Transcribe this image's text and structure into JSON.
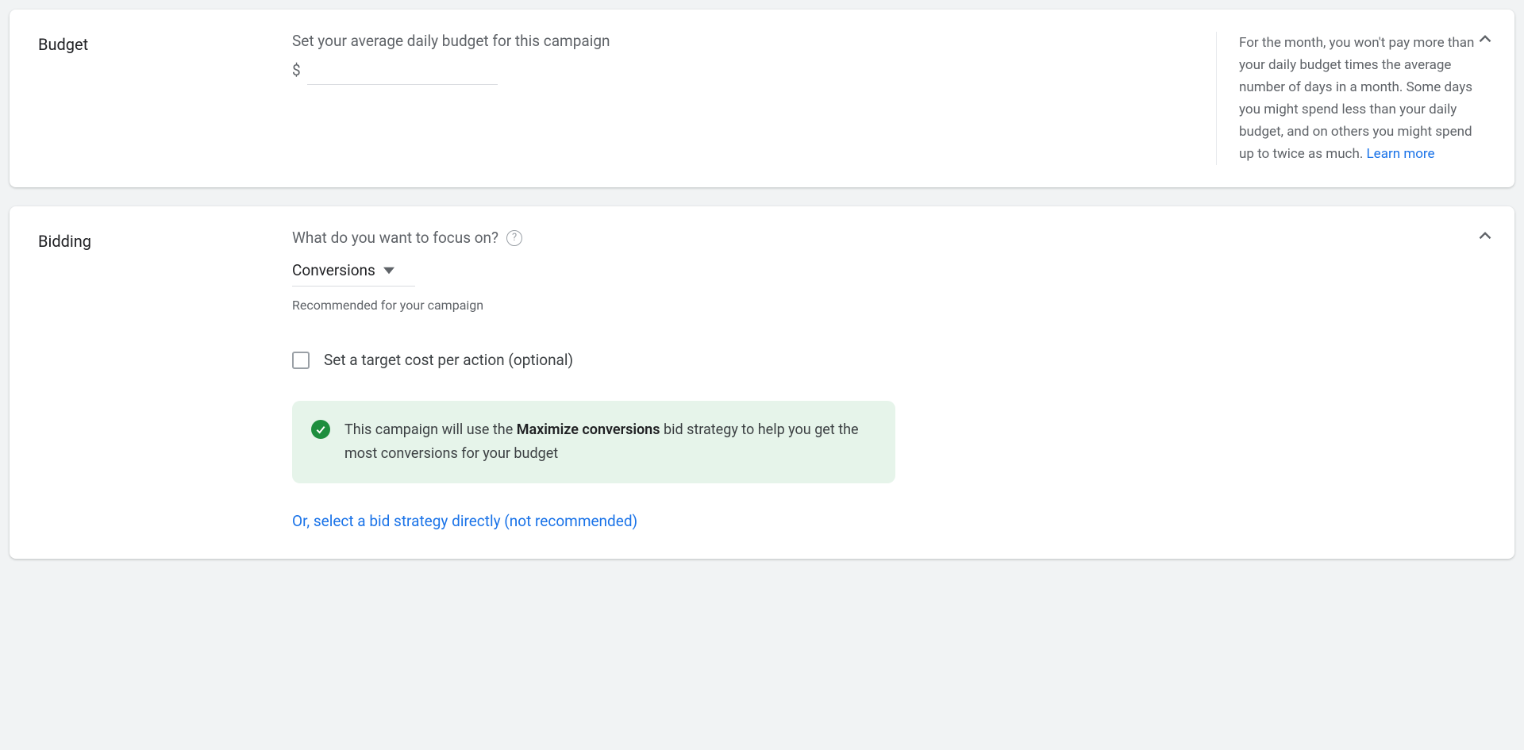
{
  "budget": {
    "title": "Budget",
    "prompt": "Set your average daily budget for this campaign",
    "currency_symbol": "$",
    "input_value": "",
    "info_text": "For the month, you won't pay more than your daily budget times the average number of days in a month. Some days you might spend less than your daily budget, and on others you might spend up to twice as much. ",
    "learn_more": "Learn more"
  },
  "bidding": {
    "title": "Bidding",
    "prompt": "What do you want to focus on?",
    "focus_value": "Conversions",
    "helper": "Recommended for your campaign",
    "target_cpa_label": "Set a target cost per action (optional)",
    "notice_pre": "This campaign will use the ",
    "notice_bold": "Maximize conversions",
    "notice_post": " bid strategy to help you get the most conversions for your budget",
    "alt_link": "Or, select a bid strategy directly (not recommended)"
  }
}
